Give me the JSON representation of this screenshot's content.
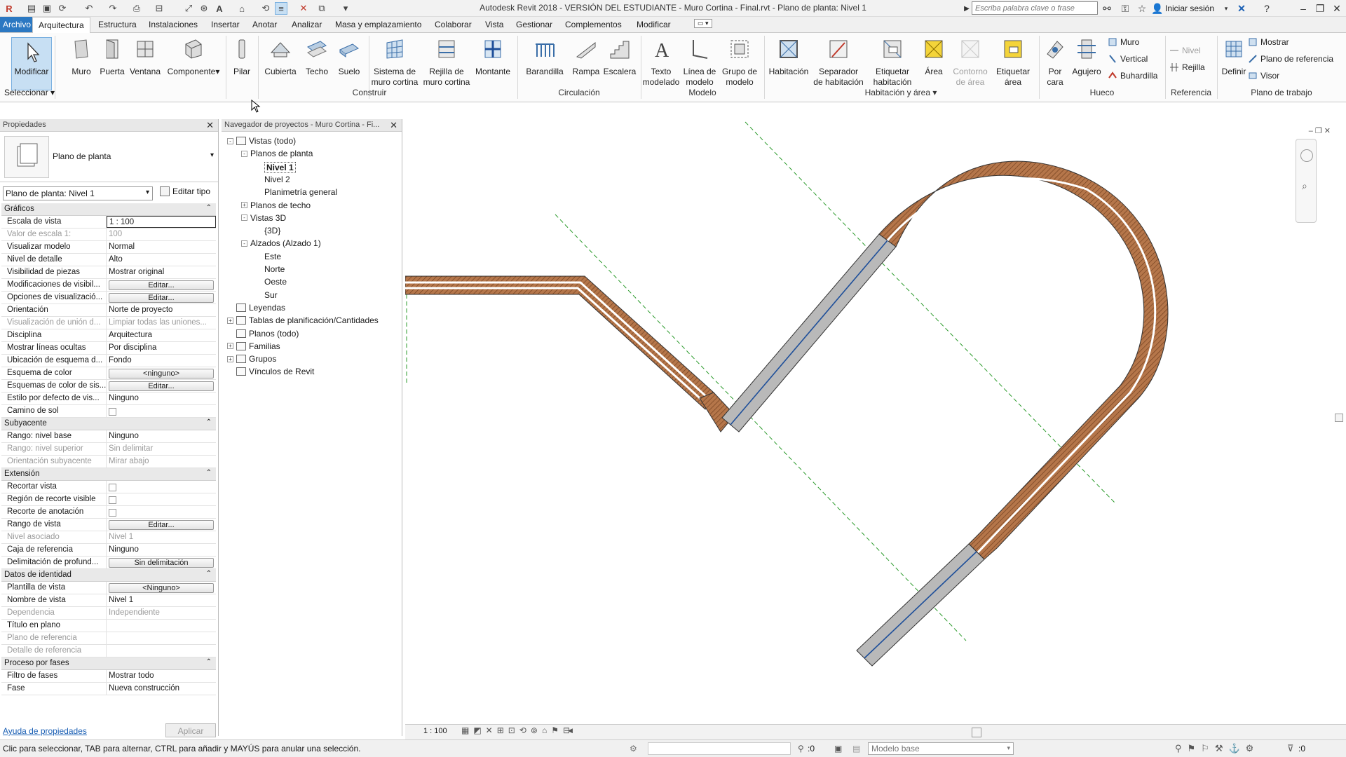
{
  "app": {
    "title": "Autodesk Revit 2018 -  VERSIÓN DEL ESTUDIANTE -     Muro Cortina - Final.rvt - Plano de planta: Nivel 1",
    "search_placeholder": "Escriba palabra clave o frase",
    "signin": "Iniciar sesión"
  },
  "menu": [
    "Archivo",
    "Arquitectura",
    "Estructura",
    "Instalaciones",
    "Insertar",
    "Anotar",
    "Analizar",
    "Masa y emplazamiento",
    "Colaborar",
    "Vista",
    "Gestionar",
    "Complementos",
    "Modificar"
  ],
  "ribbon": {
    "modificar": "Modificar",
    "seleccionar": "Seleccionar ▾",
    "construir": [
      "Muro",
      "Puerta",
      "Ventana",
      "Componente",
      "Pilar",
      "Cubierta",
      "Techo",
      "Suelo",
      "Sistema de\nmuro cortina",
      "Rejilla de\nmuro cortina",
      "Montante"
    ],
    "construir_label": "Construir",
    "circulacion": [
      "Barandilla",
      "Rampa",
      "Escalera"
    ],
    "circulacion_label": "Circulación",
    "modelo": [
      "Texto\nmodelado",
      "Línea de\nmodelo",
      "Grupo de\nmodelo"
    ],
    "modelo_label": "Modelo",
    "habitacion": [
      "Habitación",
      "Separador\nde habitación",
      "Etiquetar\nhabitación",
      "Área",
      "Contorno\nde área",
      "Etiquetar\nárea"
    ],
    "habitacion_label": "Habitación y área ▾",
    "hueco": [
      "Por\ncara",
      "Agujero"
    ],
    "hueco_small": [
      "Muro",
      "Vertical",
      "Buhardilla"
    ],
    "hueco_label": "Hueco",
    "referencia_small": [
      "Nivel",
      "Rejilla"
    ],
    "referencia_label": "Referencia",
    "plano": "Definir",
    "plano_small": [
      "Mostrar",
      "Plano de referencia",
      "Visor"
    ],
    "plano_label": "Plano de trabajo"
  },
  "properties": {
    "header": "Propiedades",
    "type_name": "Plano de planta",
    "view_selector": "Plano de planta: Nivel 1",
    "edit_type": "Editar tipo",
    "groups": [
      {
        "name": "Gráficos",
        "rows": [
          {
            "k": "Escala de vista",
            "v": "1 : 100",
            "kind": "input"
          },
          {
            "k": "Valor de escala    1:",
            "v": "100",
            "dim": true
          },
          {
            "k": "Visualizar modelo",
            "v": "Normal"
          },
          {
            "k": "Nivel de detalle",
            "v": "Alto"
          },
          {
            "k": "Visibilidad de piezas",
            "v": "Mostrar original"
          },
          {
            "k": "Modificaciones de visibil...",
            "v": "Editar...",
            "kind": "btn"
          },
          {
            "k": "Opciones de visualizació...",
            "v": "Editar...",
            "kind": "btn"
          },
          {
            "k": "Orientación",
            "v": "Norte de proyecto"
          },
          {
            "k": "Visualización de unión d...",
            "v": "Limpiar todas las uniones...",
            "dim": true
          },
          {
            "k": "Disciplina",
            "v": "Arquitectura"
          },
          {
            "k": "Mostrar líneas ocultas",
            "v": "Por disciplina"
          },
          {
            "k": "Ubicación de esquema d...",
            "v": "Fondo"
          },
          {
            "k": "Esquema de color",
            "v": "<ninguno>",
            "kind": "btn"
          },
          {
            "k": "Esquemas de color de sis...",
            "v": "Editar...",
            "kind": "btn"
          },
          {
            "k": "Estilo por defecto de vis...",
            "v": "Ninguno"
          },
          {
            "k": "Camino de sol",
            "v": "",
            "kind": "cb"
          }
        ]
      },
      {
        "name": "Subyacente",
        "rows": [
          {
            "k": "Rango: nivel base",
            "v": "Ninguno"
          },
          {
            "k": "Rango: nivel superior",
            "v": "Sin delimitar",
            "dim": true
          },
          {
            "k": "Orientación subyacente",
            "v": "Mirar abajo",
            "dim": true
          }
        ]
      },
      {
        "name": "Extensión",
        "rows": [
          {
            "k": "Recortar vista",
            "v": "",
            "kind": "cb"
          },
          {
            "k": "Región de recorte visible",
            "v": "",
            "kind": "cb"
          },
          {
            "k": "Recorte de anotación",
            "v": "",
            "kind": "cb"
          },
          {
            "k": "Rango de vista",
            "v": "Editar...",
            "kind": "btn"
          },
          {
            "k": "Nivel asociado",
            "v": "Nivel 1",
            "dim": true
          },
          {
            "k": "Caja de referencia",
            "v": "Ninguno"
          },
          {
            "k": "Delimitación de profund...",
            "v": "Sin delimitación",
            "kind": "btn"
          }
        ]
      },
      {
        "name": "Datos de identidad",
        "rows": [
          {
            "k": "Plantilla de vista",
            "v": "<Ninguno>",
            "kind": "btn"
          },
          {
            "k": "Nombre de vista",
            "v": "Nivel 1"
          },
          {
            "k": "Dependencia",
            "v": "Independiente",
            "dim": true
          },
          {
            "k": "Título en plano",
            "v": ""
          },
          {
            "k": "Plano de referencia",
            "v": "",
            "dim": true
          },
          {
            "k": "Detalle de referencia",
            "v": "",
            "dim": true
          }
        ]
      },
      {
        "name": "Proceso por fases",
        "rows": [
          {
            "k": "Filtro de fases",
            "v": "Mostrar todo"
          },
          {
            "k": "Fase",
            "v": "Nueva construcción"
          }
        ]
      }
    ],
    "help": "Ayuda de propiedades",
    "apply": "Aplicar"
  },
  "browser": {
    "header": "Navegador de proyectos - Muro Cortina - Fi...",
    "nodes": [
      {
        "t": "Vistas (todo)",
        "lvl": 0,
        "tog": "-",
        "icon": true
      },
      {
        "t": "Planos de planta",
        "lvl": 1,
        "tog": "-"
      },
      {
        "t": "Nivel 1",
        "lvl": 2,
        "bold": true
      },
      {
        "t": "Nivel 2",
        "lvl": 2
      },
      {
        "t": "Planimetría general",
        "lvl": 2
      },
      {
        "t": "Planos de techo",
        "lvl": 1,
        "tog": "+"
      },
      {
        "t": "Vistas 3D",
        "lvl": 1,
        "tog": "-"
      },
      {
        "t": "{3D}",
        "lvl": 2
      },
      {
        "t": "Alzados (Alzado 1)",
        "lvl": 1,
        "tog": "-"
      },
      {
        "t": "Este",
        "lvl": 2
      },
      {
        "t": "Norte",
        "lvl": 2
      },
      {
        "t": "Oeste",
        "lvl": 2
      },
      {
        "t": "Sur",
        "lvl": 2
      },
      {
        "t": "Leyendas",
        "lvl": 0,
        "icon": true
      },
      {
        "t": "Tablas de planificación/Cantidades",
        "lvl": 0,
        "tog": "+",
        "icon": true
      },
      {
        "t": "Planos (todo)",
        "lvl": 0,
        "icon": true
      },
      {
        "t": "Familias",
        "lvl": 0,
        "tog": "+",
        "icon": true
      },
      {
        "t": "Grupos",
        "lvl": 0,
        "tog": "+",
        "icon": true
      },
      {
        "t": "Vínculos de Revit",
        "lvl": 0,
        "icon": true
      }
    ]
  },
  "viewbar": {
    "scale": "1 : 100"
  },
  "status": {
    "text": "Clic para seleccionar, TAB para alternar, CTRL para añadir y MAYÚS para anular una selección.",
    "count": ":0",
    "model": "Modelo base",
    "filter": ":0"
  },
  "colors": {
    "wall": "#b5764a",
    "curtain": "#b9b9b9",
    "curtain_line": "#1e4f9a",
    "ref": "#2a9a2a",
    "accent": "#2b78c2"
  }
}
